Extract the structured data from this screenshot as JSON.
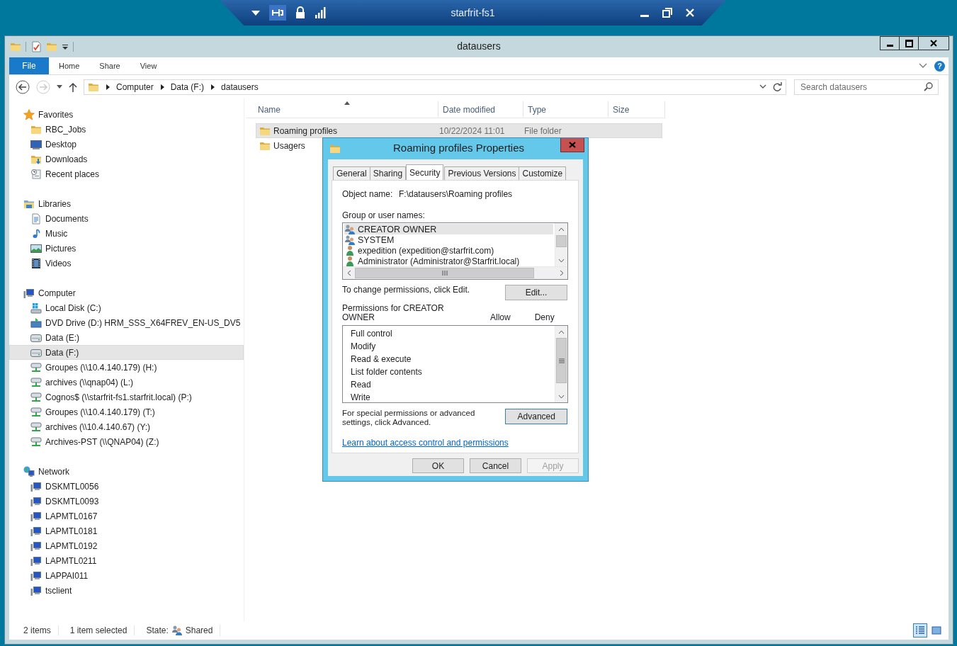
{
  "remote_bar": {
    "title": "starfrit-fs1",
    "pinned": true
  },
  "window": {
    "title": "datausers"
  },
  "ribbon": {
    "tabs": [
      {
        "label": "File",
        "kind": "menu"
      },
      {
        "label": "Home",
        "kind": "tab"
      },
      {
        "label": "Share",
        "kind": "tab"
      },
      {
        "label": "View",
        "kind": "tab"
      }
    ],
    "help": "?"
  },
  "address": {
    "crumbs": [
      "Computer",
      "Data (F:)",
      "datausers"
    ]
  },
  "search": {
    "placeholder": "Search datausers"
  },
  "nav": {
    "sections": [
      {
        "label": "Favorites",
        "kind": "star",
        "selected": false,
        "children": [
          {
            "label": "RBC_Jobs",
            "kind": "folder",
            "selected": false
          },
          {
            "label": "Desktop",
            "kind": "desktop",
            "selected": false
          },
          {
            "label": "Downloads",
            "kind": "downloads",
            "selected": false
          },
          {
            "label": "Recent places",
            "kind": "recent",
            "selected": false
          }
        ]
      },
      {
        "label": "Libraries",
        "kind": "library",
        "selected": false,
        "children": [
          {
            "label": "Documents",
            "kind": "document",
            "selected": false
          },
          {
            "label": "Music",
            "kind": "music",
            "selected": false
          },
          {
            "label": "Pictures",
            "kind": "pictures",
            "selected": false
          },
          {
            "label": "Videos",
            "kind": "videos",
            "selected": false
          }
        ]
      },
      {
        "label": "Computer",
        "kind": "computer",
        "selected": false,
        "children": [
          {
            "label": "Local Disk (C:)",
            "kind": "windrive",
            "selected": false
          },
          {
            "label": "DVD Drive (D:) HRM_SSS_X64FREV_EN-US_DV5",
            "kind": "dvd",
            "selected": false
          },
          {
            "label": "Data (E:)",
            "kind": "drive",
            "selected": false
          },
          {
            "label": "Data (F:)",
            "kind": "drive",
            "selected": true
          },
          {
            "label": "Groupes (\\\\10.4.140.179) (H:)",
            "kind": "netdrive",
            "selected": false
          },
          {
            "label": "archives (\\\\qnap04) (L:)",
            "kind": "netdrive",
            "selected": false
          },
          {
            "label": "Cognos$ (\\\\starfrit-fs1.starfrit.local) (P:)",
            "kind": "netdrive",
            "selected": false
          },
          {
            "label": "Groupes (\\\\10.4.140.179) (T:)",
            "kind": "netdrive",
            "selected": false
          },
          {
            "label": "archives (\\\\10.4.140.67) (Y:)",
            "kind": "netdrive",
            "selected": false
          },
          {
            "label": "Archives-PST (\\\\QNAP04) (Z:)",
            "kind": "netdrive",
            "selected": false
          }
        ]
      },
      {
        "label": "Network",
        "kind": "network",
        "selected": false,
        "children": [
          {
            "label": "DSKMTL0056",
            "kind": "computer",
            "selected": false
          },
          {
            "label": "DSKMTL0093",
            "kind": "computer",
            "selected": false
          },
          {
            "label": "LAPMTL0167",
            "kind": "computer",
            "selected": false
          },
          {
            "label": "LAPMTL0181",
            "kind": "computer",
            "selected": false
          },
          {
            "label": "LAPMTL0192",
            "kind": "computer",
            "selected": false
          },
          {
            "label": "LAPMTL0211",
            "kind": "computer",
            "selected": false
          },
          {
            "label": "LAPPAI011",
            "kind": "computer",
            "selected": false
          },
          {
            "label": "tsclient",
            "kind": "computer",
            "selected": false
          }
        ]
      }
    ]
  },
  "files": {
    "columns": [
      "Name",
      "Date modified",
      "Type",
      "Size"
    ],
    "rows": [
      {
        "name": "Roaming profiles",
        "date": "10/22/2024 11:01",
        "type": "File folder",
        "selected": true
      },
      {
        "name": "Usagers",
        "selected": false
      }
    ]
  },
  "status": {
    "count": "2 items",
    "selection": "1 item selected",
    "state_label": "State:",
    "state": "Shared"
  },
  "view_buttons": [
    {
      "kind": "details",
      "selected": true
    },
    {
      "kind": "icons",
      "selected": false
    }
  ],
  "dialog": {
    "title": "Roaming profiles Properties",
    "tabs": [
      {
        "label": "General",
        "selected": false
      },
      {
        "label": "Sharing",
        "selected": false
      },
      {
        "label": "Security",
        "selected": true
      },
      {
        "label": "Previous Versions",
        "selected": false
      },
      {
        "label": "Customize",
        "selected": false
      }
    ],
    "object_label": "Object name:",
    "object_value": "F:\\datausers\\Roaming profiles",
    "group_label": "Group or user names:",
    "users": [
      {
        "name": "CREATOR OWNER",
        "kind": "group",
        "selected": true
      },
      {
        "name": "SYSTEM",
        "kind": "group",
        "selected": false
      },
      {
        "name": "expedition (expedition@starfrit.com)",
        "kind": "user",
        "selected": false
      },
      {
        "name": "Administrator (Administrator@Starfrit.local)",
        "kind": "user",
        "selected": false
      }
    ],
    "edit_hint": "To change permissions, click Edit.",
    "edit_button": "Edit...",
    "permissions_label": "Permissions for CREATOR OWNER",
    "allow_label": "Allow",
    "deny_label": "Deny",
    "permissions": [
      "Full control",
      "Modify",
      "Read & execute",
      "List folder contents",
      "Read",
      "Write"
    ],
    "advanced_hint": "For special permissions or advanced settings, click Advanced.",
    "advanced_button": "Advanced",
    "link": "Learn about access control and permissions",
    "buttons": [
      {
        "label": "OK",
        "disabled": false
      },
      {
        "label": "Cancel",
        "disabled": false
      },
      {
        "label": "Apply",
        "disabled": true
      }
    ]
  }
}
